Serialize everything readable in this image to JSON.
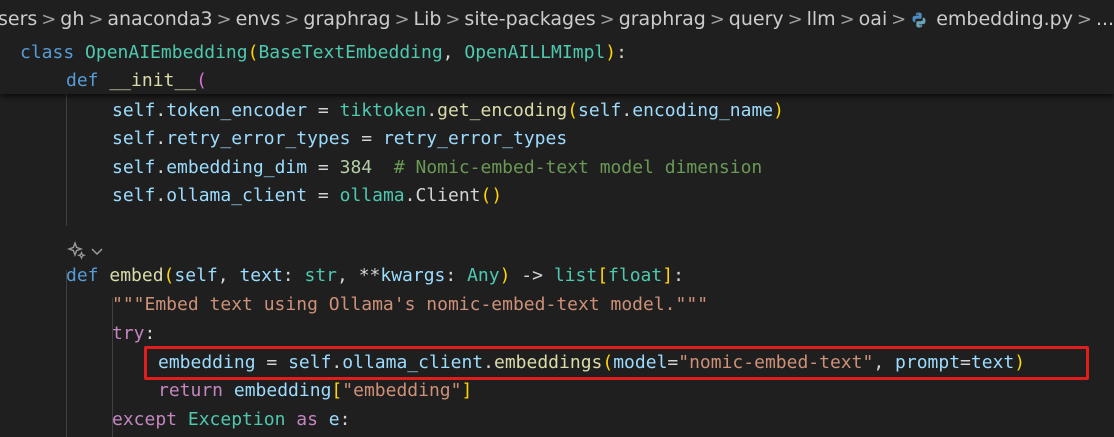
{
  "breadcrumb": {
    "segments": [
      "sers",
      "gh",
      "anaconda3",
      "envs",
      "graphrag",
      "Lib",
      "site-packages",
      "graphrag",
      "query",
      "llm",
      "oai"
    ],
    "file_name": "embedding.py",
    "ellipsis": "...",
    "separator": ">"
  },
  "code": {
    "class_kw": "class",
    "class_name": "OpenAIEmbedding",
    "base1": "BaseTextEmbedding",
    "base2": "OpenAILLMImpl",
    "def_kw": "def",
    "init_name": "__init__",
    "self": "self",
    "token_encoder_attr": "token_encoder",
    "tiktoken": "tiktoken",
    "get_encoding": "get_encoding",
    "encoding_name_attr": "encoding_name",
    "retry_error_types_attr": "retry_error_types",
    "retry_error_types_val": "retry_error_types",
    "embedding_dim_attr": "embedding_dim",
    "dim_value": "384",
    "dim_comment": "# Nomic-embed-text model dimension",
    "ollama_client_attr": "ollama_client",
    "ollama_mod": "ollama",
    "client_cls": "Client",
    "embed_name": "embed",
    "text_param": "text",
    "str_type": "str",
    "kwargs_op": "**",
    "kwargs_param": "kwargs",
    "any_type": "Any",
    "arrow": "->",
    "list_type": "list",
    "float_type": "float",
    "docstring": "\"\"\"Embed text using Ollama's nomic-embed-text model.\"\"\"",
    "try_kw": "try",
    "embedding_var": "embedding",
    "embeddings_method": "embeddings",
    "model_param": "model",
    "model_value": "\"nomic-embed-text\"",
    "prompt_param": "prompt",
    "text_arg": "text",
    "return_kw": "return",
    "embedding_key": "\"embedding\"",
    "except_kw": "except",
    "exception_cls": "Exception",
    "as_kw": "as",
    "e_var": "e"
  },
  "colors": {
    "background": "#1f1f1f",
    "keyword": "#569cd6",
    "control": "#c586c0",
    "class": "#4ec9b0",
    "function": "#dcdcaa",
    "variable": "#9cdcfe",
    "string": "#ce9178",
    "number": "#b5cea8",
    "comment": "#6a9955",
    "highlight_box": "#e01e1e"
  }
}
